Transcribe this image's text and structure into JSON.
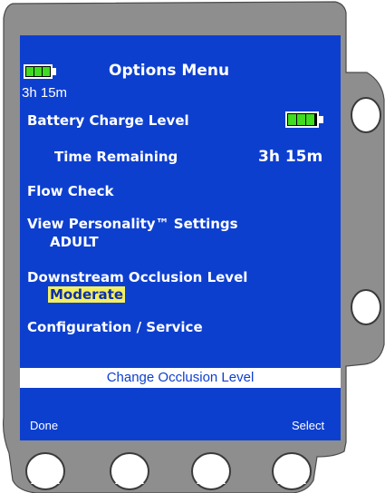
{
  "header": {
    "title": "Options Menu",
    "battery_time": "3h 15m"
  },
  "menu": {
    "battery_charge_label": "Battery Charge Level",
    "time_remaining_label": "Time Remaining",
    "time_remaining_value": "3h 15m",
    "flow_check_label": "Flow Check",
    "personality_label": "View Personality™ Settings",
    "personality_value": "ADULT",
    "occlusion_label": "Downstream Occlusion Level",
    "occlusion_value": "Moderate",
    "config_label": "Configuration / Service"
  },
  "status_bar": "Change Occlusion Level",
  "softkeys": {
    "left": "Done",
    "right": "Select"
  },
  "battery": {
    "level_cells": 3,
    "max_cells": 3,
    "cell_color": "#3fdc20"
  },
  "colors": {
    "screen": "#0d3fcf",
    "highlight": "#f3ef62",
    "bezel": "#8e8e8e"
  },
  "icons": {
    "up": "triangle-up-icon",
    "down": "triangle-down-icon",
    "softkey": "triangle-up-icon"
  }
}
